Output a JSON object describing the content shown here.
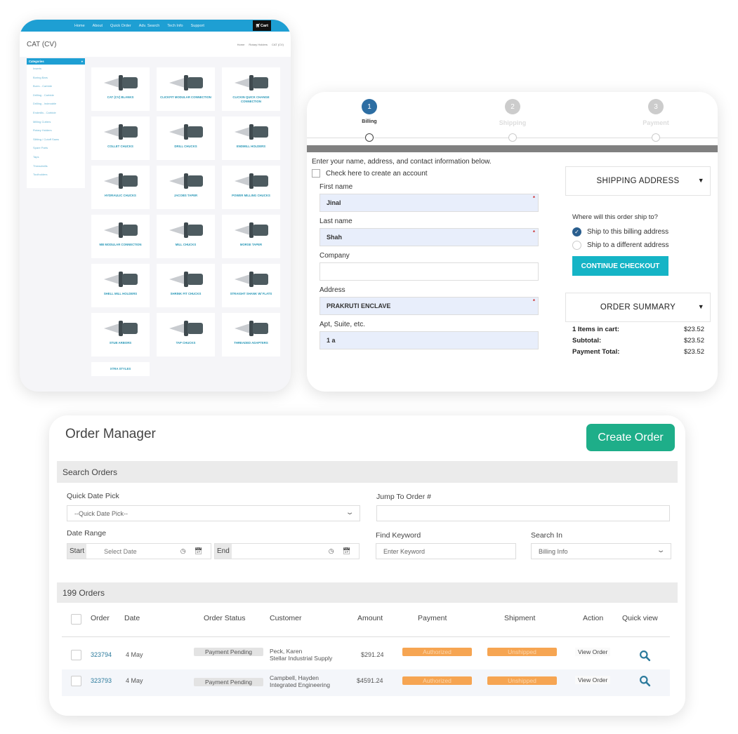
{
  "catalog": {
    "nav": [
      "Home",
      "About",
      "Quick Order",
      "Adv. Search",
      "Tech Info",
      "Support"
    ],
    "cart_label": "Cart",
    "page_title": "CAT (CV)",
    "breadcrumb": [
      "Home",
      "Rotary Holders",
      "CAT (CV)"
    ],
    "sidebar": {
      "title": "Categories",
      "items": [
        "Inserts",
        "Boring Bars",
        "Burrs - Carbide",
        "Drilling - Carbide",
        "Drilling - Indexable",
        "Endmills - Carbide",
        "Milling Cutters",
        "Rotary Holders",
        "Slitting / Cutoff Saws",
        "Spare Parts",
        "Taps",
        "Threadmills",
        "Toolholders"
      ]
    },
    "products": [
      "CAT (CV) BLANKS",
      "CLICKFIT MODULAR CONNECTION",
      "CLICKIN QUICK CHANGE CONNECTION",
      "COLLET CHUCKS",
      "DRILL CHUCKS",
      "ENDMILL HOLDERS",
      "HYDRAULIC CHUCKS",
      "JACOBS TAPER",
      "POWER MILLING CHUCKS",
      "MB MODULAR CONNECTION",
      "MILL CHUCKS",
      "MORSE TAPER",
      "SHELL MILL HOLDERS",
      "SHRINK FIT CHUCKS",
      "STRAIGHT SHANK W/ FLATS",
      "STUB ARBORS",
      "TAP CHUCKS",
      "THREADED ADAPTERS"
    ],
    "extra_tile": "XTRA STYLES"
  },
  "checkout": {
    "steps": [
      {
        "num": "1",
        "label": "Billing",
        "active": true
      },
      {
        "num": "2",
        "label": "Shipping",
        "active": false
      },
      {
        "num": "3",
        "label": "Payment",
        "active": false
      }
    ],
    "intro": "Enter your name, address, and contact information below.",
    "create_account": "Check here to create an account",
    "fields": {
      "first_name": {
        "label": "First name",
        "value": "Jinal"
      },
      "last_name": {
        "label": "Last name",
        "value": "Shah"
      },
      "company": {
        "label": "Company",
        "value": ""
      },
      "address": {
        "label": "Address",
        "value": "PRAKRUTI ENCLAVE"
      },
      "apt": {
        "label": "Apt, Suite, etc.",
        "value": "1 a"
      }
    },
    "required_mark": "*",
    "shipping_address_title": "SHIPPING ADDRESS",
    "ship_question": "Where will this order ship to?",
    "ship_options": [
      "Ship to this billing address",
      "Ship to a different address"
    ],
    "ship_selected": 0,
    "continue_label": "CONTINUE CHECKOUT",
    "order_summary_title": "ORDER SUMMARY",
    "summary": [
      {
        "label": "1 Items in cart:",
        "value": "$23.52"
      },
      {
        "label": "Subtotal:",
        "value": "$23.52"
      },
      {
        "label": "Payment Total:",
        "value": "$23.52"
      }
    ]
  },
  "orders": {
    "title": "Order Manager",
    "create_label": "Create Order",
    "search_band": "Search Orders",
    "quick_date_label": "Quick Date Pick",
    "quick_date_value": "--Quick Date Pick--",
    "jump_label": "Jump To Order #",
    "jump_value": "",
    "date_range_label": "Date Range",
    "start_label": "Start",
    "start_placeholder": "Select Date",
    "end_label": "End",
    "find_keyword_label": "Find Keyword",
    "find_keyword_placeholder": "Enter Keyword",
    "search_in_label": "Search In",
    "search_in_value": "Billing Info",
    "count_band": "199 Orders",
    "columns": [
      "Order",
      "Date",
      "Order Status",
      "Customer",
      "Amount",
      "Payment",
      "Shipment",
      "Action",
      "Quick view"
    ],
    "rows": [
      {
        "order": "323794",
        "date": "4 May",
        "status": "Payment Pending",
        "customer_name": "Peck, Karen",
        "customer_company": "Stellar Industrial Supply",
        "amount": "$291.24",
        "payment": "Authorized",
        "shipment": "Unshipped",
        "action": "View Order"
      },
      {
        "order": "323793",
        "date": "4 May",
        "status": "Payment Pending",
        "customer_name": "Campbell, Hayden",
        "customer_company": "Integrated Engineering",
        "amount": "$4591.24",
        "payment": "Authorized",
        "shipment": "Unshipped",
        "action": "View Order"
      }
    ]
  },
  "colors": {
    "catalog_blue": "#1e9fd3",
    "step_active": "#2d6ea3",
    "continue_teal": "#15b4c6",
    "create_green": "#1eae89",
    "badge_orange": "#f6a552",
    "link_blue": "#2b7a9c"
  }
}
